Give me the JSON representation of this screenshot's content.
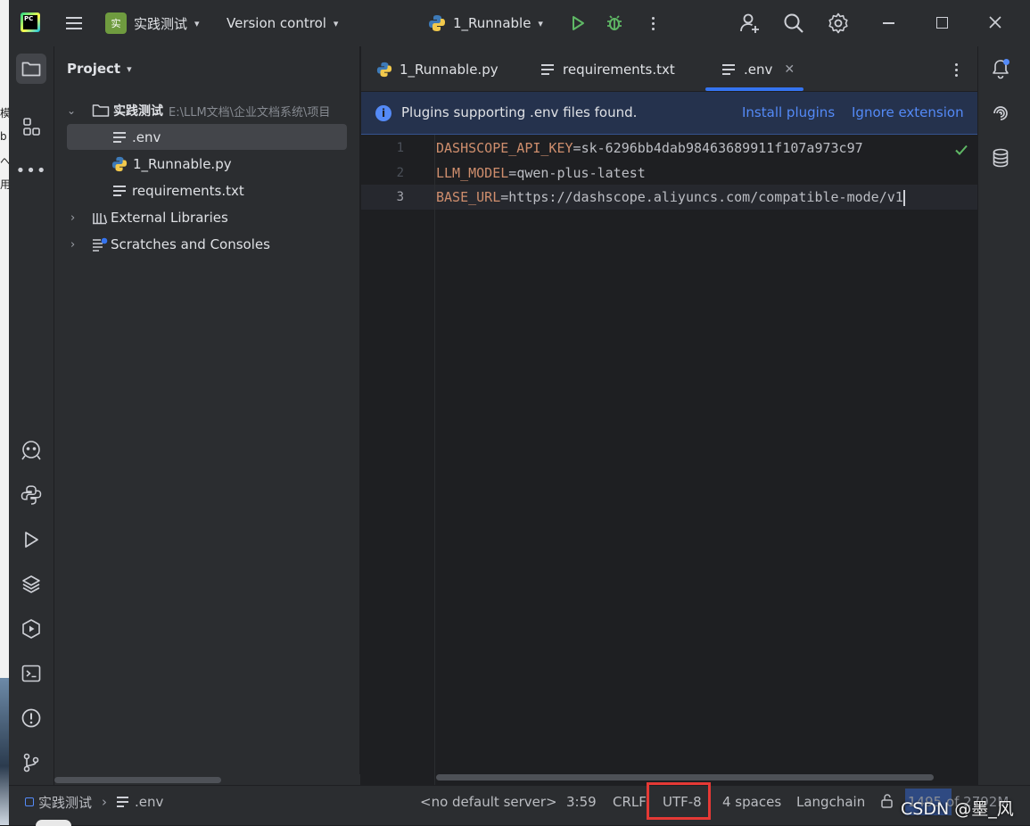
{
  "titlebar": {
    "project_badge": "实",
    "project_name": "实践测试",
    "vcs_label": "Version control",
    "run_config": "1_Runnable"
  },
  "project_panel": {
    "title": "Project",
    "tree": {
      "root_name": "实践测试",
      "root_path": "E:\\LLM文档\\企业文档系统\\项目",
      "files": [
        ".env",
        "1_Runnable.py",
        "requirements.txt"
      ],
      "external_libraries": "External Libraries",
      "scratches": "Scratches and Consoles"
    }
  },
  "tabs": [
    {
      "label": "1_Runnable.py"
    },
    {
      "label": "requirements.txt"
    },
    {
      "label": ".env",
      "active": true
    }
  ],
  "banner": {
    "message": "Plugins supporting .env files found.",
    "install": "Install plugins",
    "ignore": "Ignore extension"
  },
  "editor": {
    "lines": [
      {
        "num": "1",
        "key": "DASHSCOPE_API_KEY",
        "eq": "=",
        "value": "sk-6296bb4dab98463689911f107a973c97"
      },
      {
        "num": "2",
        "key": "LLM_MODEL",
        "eq": "=",
        "value": "qwen-plus-latest"
      },
      {
        "num": "3",
        "key": "BASE_URL",
        "eq": "=",
        "value": "https://dashscope.aliyuncs.com/compatible-mode/v1"
      }
    ]
  },
  "status": {
    "breadcrumb_project": "实践测试",
    "breadcrumb_file": ".env",
    "server": "<no default server>",
    "position": "3:59",
    "line_sep": "CRLF",
    "encoding": "UTF-8",
    "indent": "4 spaces",
    "interpreter": "Langchain",
    "memory": "1495 of 2792M",
    "watermark": "CSDN @墨_风"
  },
  "desktop_fragments": [
    "模",
    "b",
    "へ",
    "用"
  ],
  "colors": {
    "accent": "#3574f0",
    "key": "#cf8e6d",
    "run_green": "#5fb865",
    "highlight_red": "#e53935"
  }
}
